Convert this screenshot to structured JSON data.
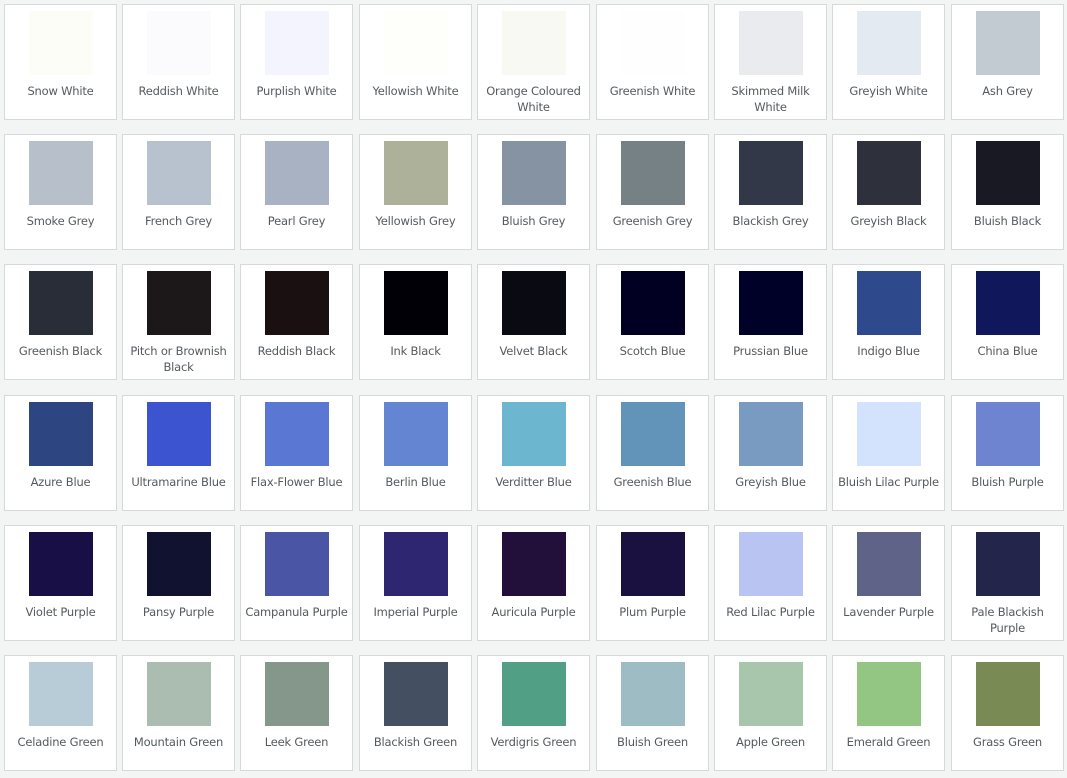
{
  "swatches": [
    [
      {
        "name": "Snow White",
        "color": "#fdfdf8"
      },
      {
        "name": "Reddish White",
        "color": "#fbfbfe"
      },
      {
        "name": "Purplish White",
        "color": "#f4f4fe"
      },
      {
        "name": "Yellowish White",
        "color": "#fefefa"
      },
      {
        "name": "Orange Coloured White",
        "color": "#f9f9f3"
      },
      {
        "name": "Greenish White",
        "color": "#fefefe"
      },
      {
        "name": "Skimmed Milk White",
        "color": "#e9ebef"
      },
      {
        "name": "Greyish White",
        "color": "#e4eaf2"
      },
      {
        "name": "Ash Grey",
        "color": "#c1cbd1"
      }
    ],
    [
      {
        "name": "Smoke Grey",
        "color": "#b7bfca"
      },
      {
        "name": "French Grey",
        "color": "#b8c2ce"
      },
      {
        "name": "Pearl Grey",
        "color": "#a9b2c3"
      },
      {
        "name": "Yellowish Grey",
        "color": "#adb19a"
      },
      {
        "name": "Bluish Grey",
        "color": "#8693a2"
      },
      {
        "name": "Greenish Grey",
        "color": "#758184"
      },
      {
        "name": "Blackish Grey",
        "color": "#333848"
      },
      {
        "name": "Greyish Black",
        "color": "#2e313b"
      },
      {
        "name": "Bluish Black",
        "color": "#191924"
      }
    ],
    [
      {
        "name": "Greenish Black",
        "color": "#282d37"
      },
      {
        "name": "Pitch or Brownish Black",
        "color": "#1c1718"
      },
      {
        "name": "Reddish Black",
        "color": "#1a1011"
      },
      {
        "name": "Ink Black",
        "color": "#010006"
      },
      {
        "name": "Velvet Black",
        "color": "#0a0a12"
      },
      {
        "name": "Scotch Blue",
        "color": "#010023"
      },
      {
        "name": "Prussian Blue",
        "color": "#000128"
      },
      {
        "name": "Indigo Blue",
        "color": "#2e4a8d"
      },
      {
        "name": "China Blue",
        "color": "#10175a"
      }
    ],
    [
      {
        "name": "Azure Blue",
        "color": "#2d4580"
      },
      {
        "name": "Ultramarine Blue",
        "color": "#3d54d0"
      },
      {
        "name": "Flax-Flower Blue",
        "color": "#5977d3"
      },
      {
        "name": "Berlin Blue",
        "color": "#6385d2"
      },
      {
        "name": "Verditter Blue",
        "color": "#6db6cf"
      },
      {
        "name": "Greenish Blue",
        "color": "#6194b8"
      },
      {
        "name": "Greyish Blue",
        "color": "#7a9bc1"
      },
      {
        "name": "Bluish Lilac Purple",
        "color": "#d3e3fd"
      },
      {
        "name": "Bluish Purple",
        "color": "#6f84d0"
      }
    ],
    [
      {
        "name": "Violet Purple",
        "color": "#170f46"
      },
      {
        "name": "Pansy Purple",
        "color": "#111130"
      },
      {
        "name": "Campanula Purple",
        "color": "#4b55a6"
      },
      {
        "name": "Imperial Purple",
        "color": "#2e2670"
      },
      {
        "name": "Auricula Purple",
        "color": "#23103a"
      },
      {
        "name": "Plum Purple",
        "color": "#1a1141"
      },
      {
        "name": "Red Lilac Purple",
        "color": "#bac4f2"
      },
      {
        "name": "Lavender Purple",
        "color": "#5e6387"
      },
      {
        "name": "Pale Blackish Purple",
        "color": "#24254a"
      }
    ],
    [
      {
        "name": "Celadine Green",
        "color": "#b8ccd8"
      },
      {
        "name": "Mountain Green",
        "color": "#abbcb1"
      },
      {
        "name": "Leek Green",
        "color": "#85968a"
      },
      {
        "name": "Blackish Green",
        "color": "#445062"
      },
      {
        "name": "Verdigris Green",
        "color": "#51a086"
      },
      {
        "name": "Bluish Green",
        "color": "#9dbcc3"
      },
      {
        "name": "Apple Green",
        "color": "#a8c6ac"
      },
      {
        "name": "Emerald Green",
        "color": "#94c683"
      },
      {
        "name": "Grass Green",
        "color": "#7a8a54"
      }
    ]
  ]
}
